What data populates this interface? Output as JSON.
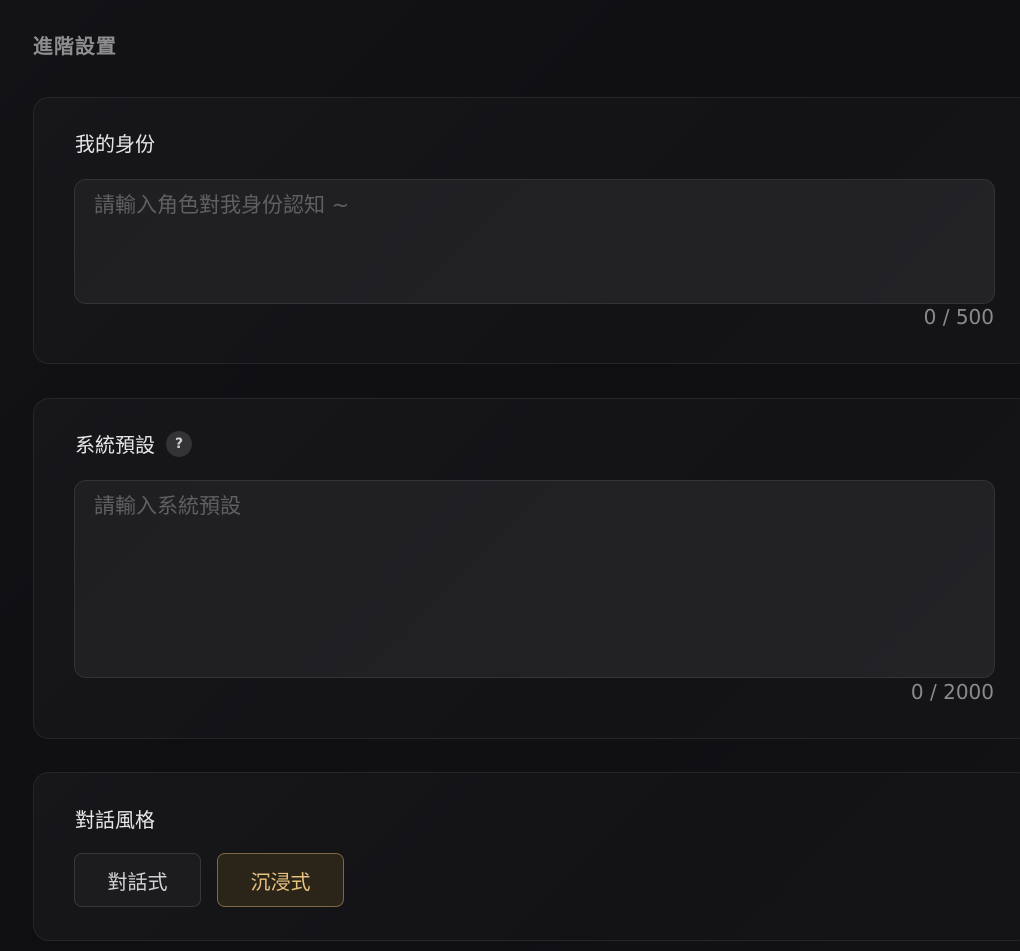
{
  "section": {
    "title": "進階設置"
  },
  "identity": {
    "label": "我的身份",
    "placeholder": "請輸入角色對我身份認知 ~",
    "value": "",
    "counter": "0 / 500"
  },
  "system_preset": {
    "label": "系統預設",
    "help_glyph": "?",
    "placeholder": "請輸入系統預設",
    "value": "",
    "counter": "0 / 2000"
  },
  "dialog_style": {
    "label": "對話風格",
    "options": [
      {
        "label": "對話式",
        "selected": false
      },
      {
        "label": "沉浸式",
        "selected": true
      }
    ]
  },
  "colors": {
    "accent": "#e8c27e",
    "accent_border": "#7b6a42"
  }
}
